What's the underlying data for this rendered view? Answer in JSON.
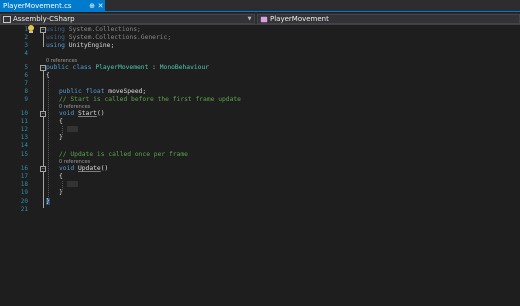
{
  "tab": {
    "title": "PlayerMovement.cs",
    "pin": "⊕",
    "close": "✕"
  },
  "navbar": {
    "project": "Assembly-CSharp",
    "member": "PlayerMovement"
  },
  "editor": {
    "line_numbers": [
      "1",
      "2",
      "3",
      "4",
      "5",
      "6",
      "7",
      "8",
      "9",
      "10",
      "11",
      "12",
      "13",
      "14",
      "15",
      "16",
      "17",
      "18",
      "19",
      "20",
      "21"
    ],
    "lens": {
      "class_refs": "0 references",
      "start_refs": "0 references",
      "update_refs": "0 references"
    },
    "lines": {
      "l1": {
        "kw": "using",
        "rest": " System.Collections;"
      },
      "l2": {
        "kw": "using",
        "rest": " System.Collections.Generic;"
      },
      "l3": {
        "kw": "using",
        "rest": " UnityEngine;"
      },
      "l5": {
        "kw1": "public",
        "kw2": "class",
        "name": "PlayerMovement",
        "colon": " : ",
        "base": "MonoBehaviour"
      },
      "l6": "{",
      "l8": {
        "kw1": "public",
        "kw2": "float",
        "rest": " moveSpeed;"
      },
      "l9": "// Start is called before the first frame update",
      "l10": {
        "kw": "void",
        "name": "Start",
        "parens": "()"
      },
      "l11": "{",
      "l13": "}",
      "l15": "// Update is called once per frame",
      "l16": {
        "kw": "void",
        "name": "Update",
        "parens": "()"
      },
      "l17": "{",
      "l19": "}",
      "l20": "}"
    }
  },
  "colors": {
    "accent": "#007acc",
    "keyword": "#569cd6",
    "type": "#4ec9b0",
    "comment": "#57a64a",
    "line_number": "#2b91af"
  }
}
